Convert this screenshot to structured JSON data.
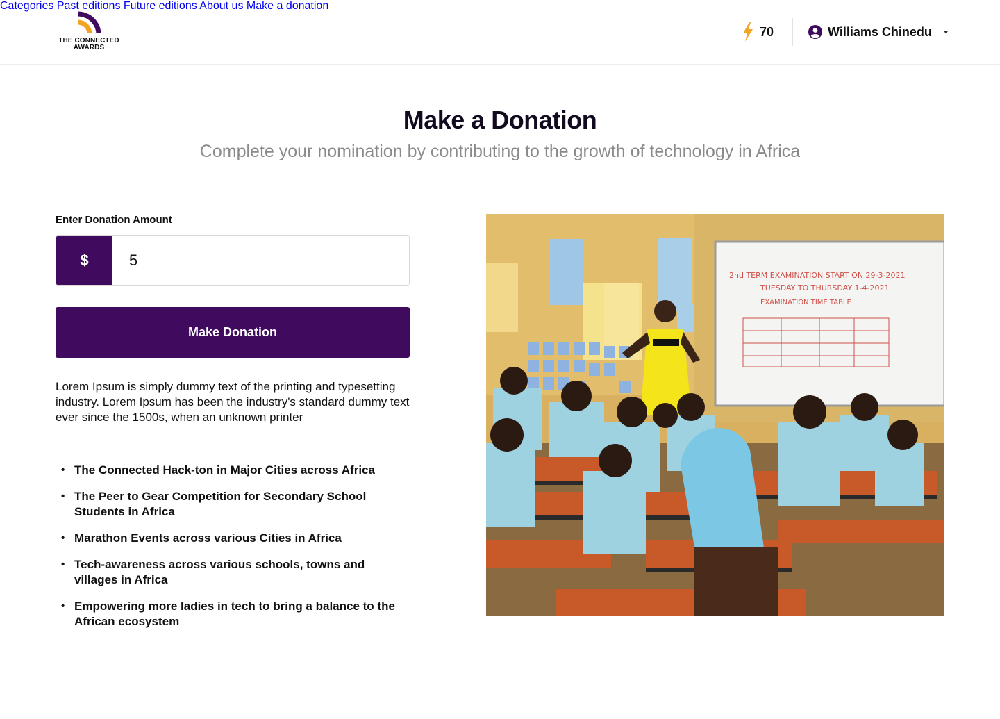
{
  "brand": {
    "logo_line1": "THE CONNECTED",
    "logo_line2": "AWARDS",
    "primary_color": "#400a5e",
    "accent_color": "#f2a524"
  },
  "nav": {
    "items": [
      {
        "label": "Categories"
      },
      {
        "label": "Past editions"
      },
      {
        "label": "Future editions"
      },
      {
        "label": "About us"
      },
      {
        "label": "Make a donation"
      }
    ]
  },
  "header": {
    "points_icon": "lightning-icon",
    "points": "70",
    "user_icon": "user-circle-icon",
    "user_name": "Williams Chinedu",
    "dropdown_icon": "caret-down-icon"
  },
  "page": {
    "title": "Make a Donation",
    "subtitle": "Complete your nomination by contributing to the growth of technology in Africa"
  },
  "form": {
    "amount_label": "Enter Donation Amount",
    "currency_symbol": "$",
    "amount_value": "5",
    "submit_label": "Make Donation"
  },
  "content": {
    "description": "Lorem Ipsum is simply dummy text of the printing and typesetting industry. Lorem Ipsum has been the industry's standard dummy text ever since the 1500s, when an unknown printer",
    "bullets": [
      "The Connected Hack-ton in Major Cities across Africa",
      "The Peer to Gear  Competition for Secondary School Students in Africa",
      "Marathon Events across various Cities in Africa",
      "Tech-awareness across various schools, towns and villages in Africa",
      "Empowering more ladies in tech to bring a balance to the African ecosystem"
    ]
  },
  "image": {
    "whiteboard_line1": "2nd TERM EXAMINATION START ON 29-3-2021",
    "whiteboard_line2": "TUESDAY TO THURSDAY 1-4-2021",
    "whiteboard_line3": "EXAMINATION TIME TABLE"
  }
}
